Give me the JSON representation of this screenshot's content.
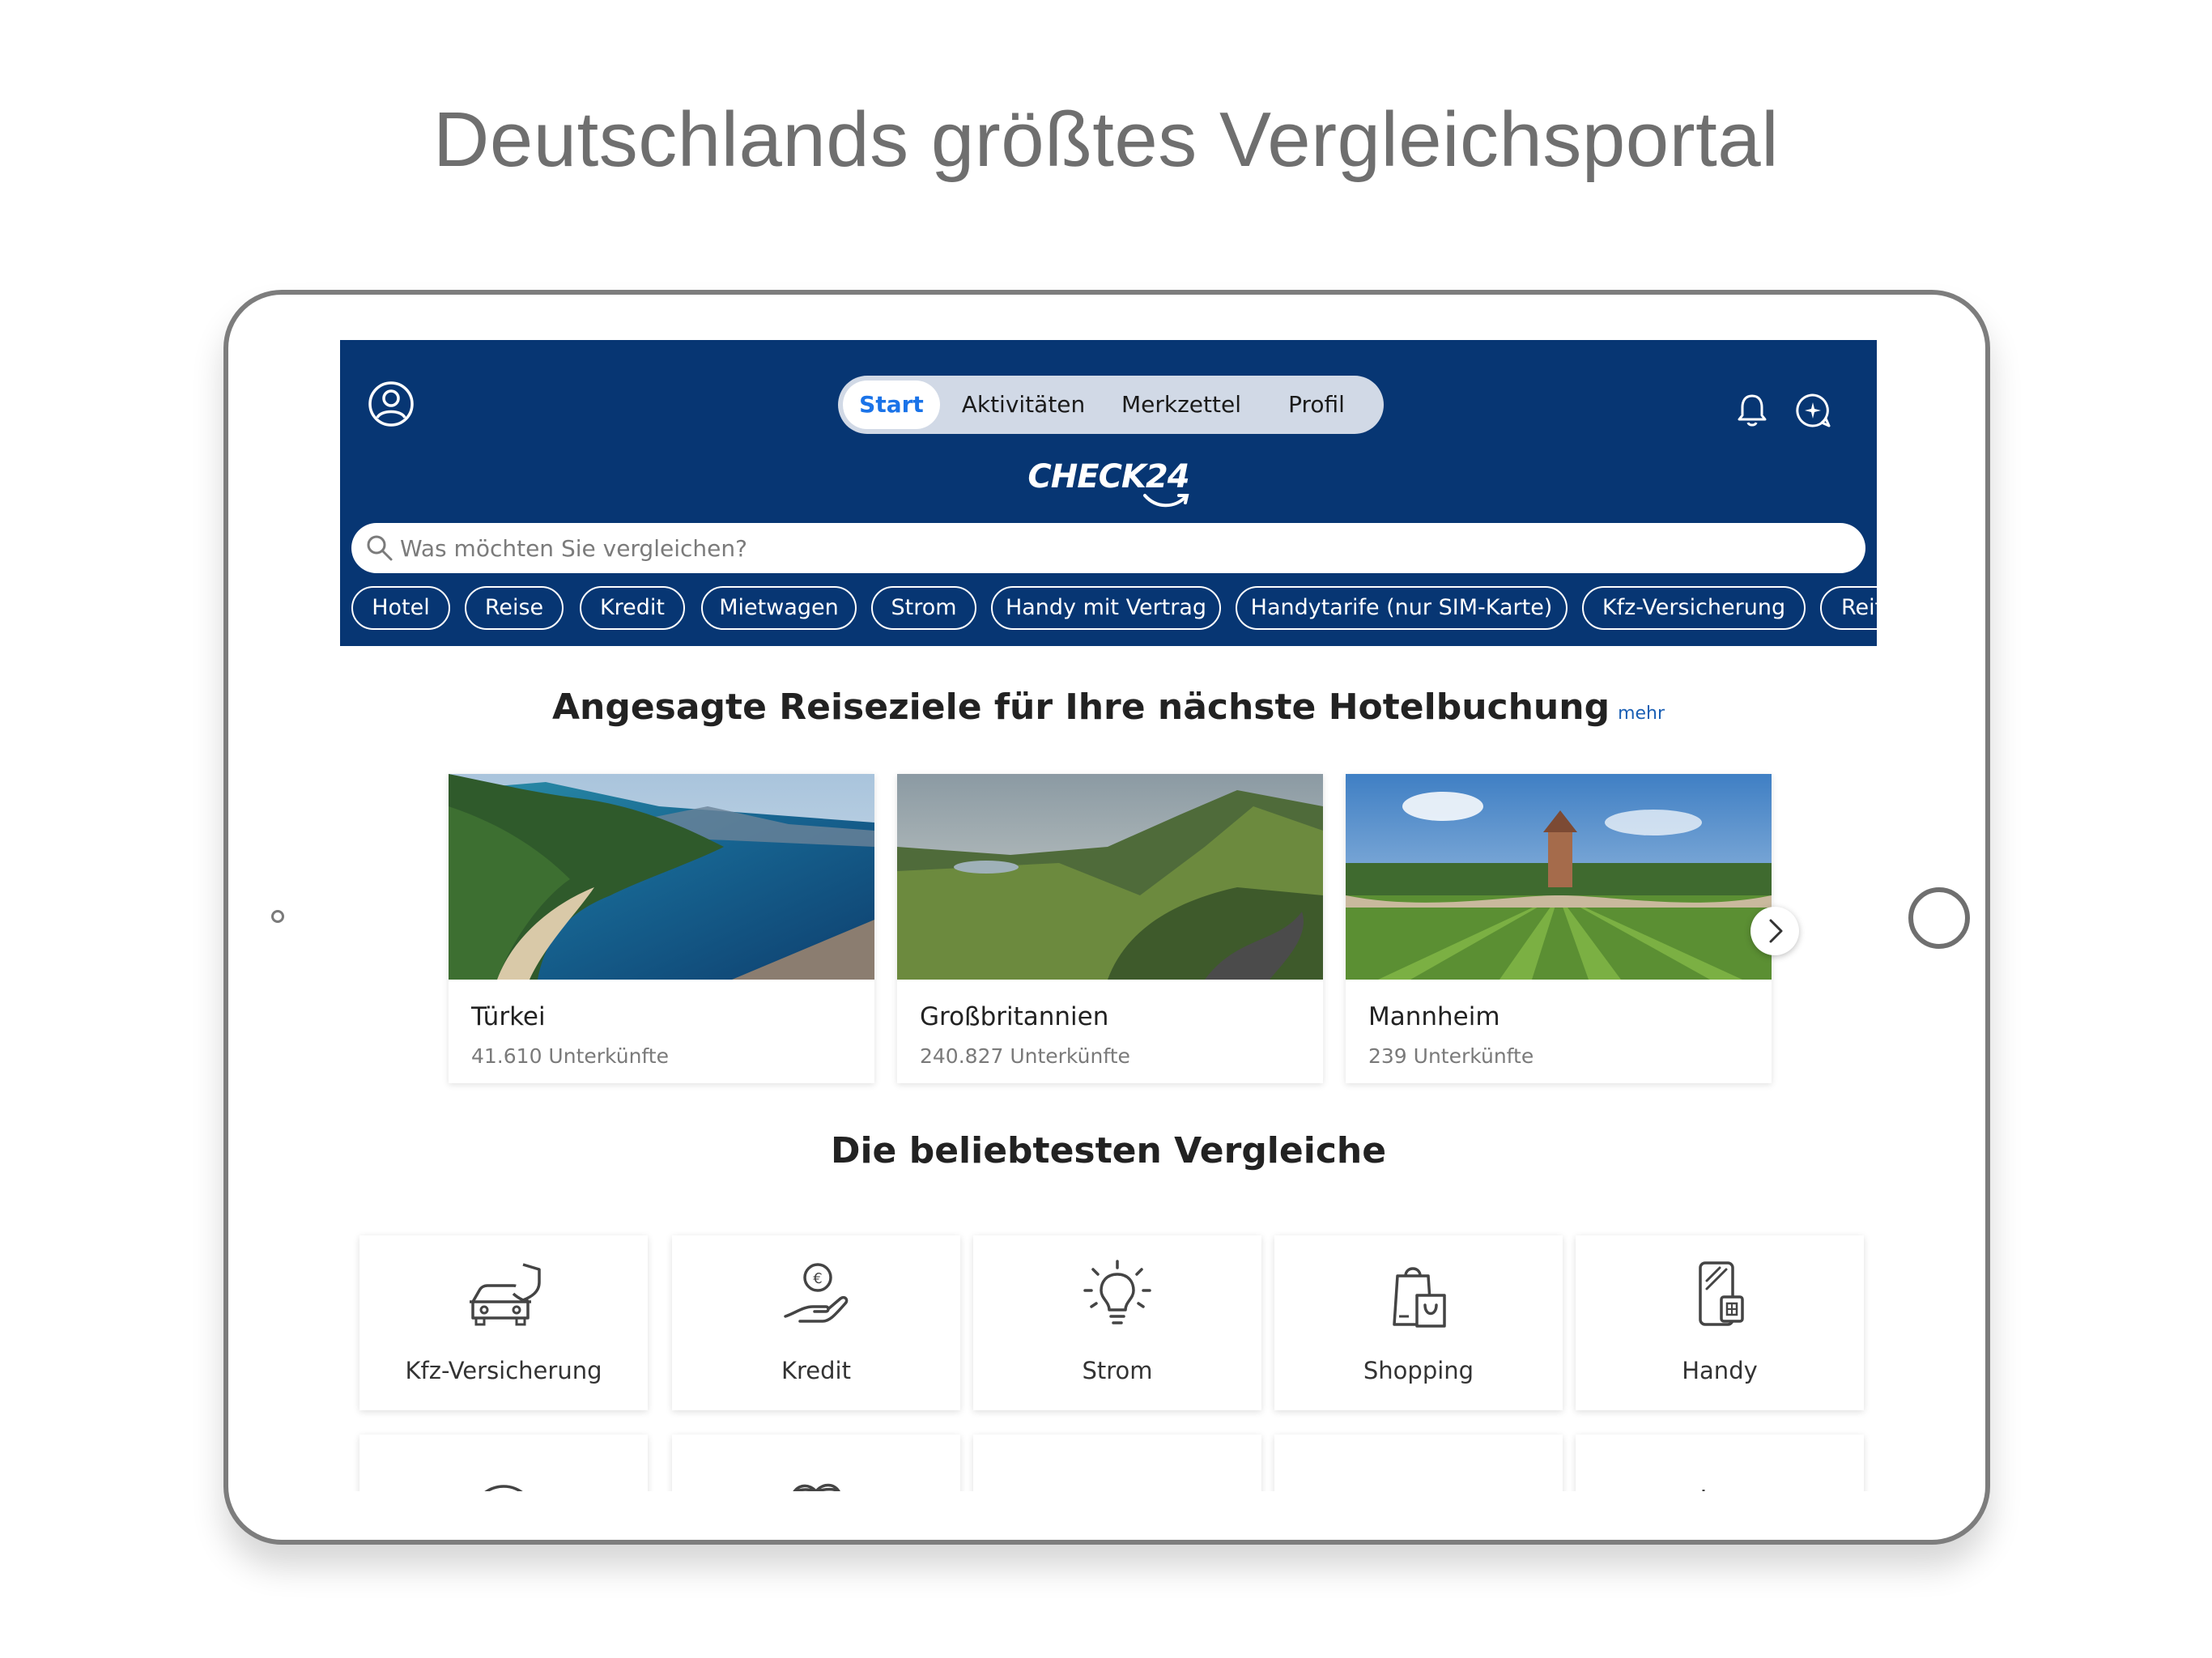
{
  "headline": "Deutschlands größtes Vergleichsportal",
  "header": {
    "nav_tabs": [
      {
        "label": "Start",
        "active": true
      },
      {
        "label": "Aktivitäten",
        "active": false
      },
      {
        "label": "Merkzettel",
        "active": false
      },
      {
        "label": "Profil",
        "active": false
      }
    ],
    "logo": "CHECK24",
    "search_placeholder": "Was möchten Sie vergleichen?",
    "chips": [
      "Hotel",
      "Reise",
      "Kredit",
      "Mietwagen",
      "Strom",
      "Handy mit Vertrag",
      "Handytarife (nur SIM-Karte)",
      "Kfz-Versicherung",
      "Reifen"
    ]
  },
  "hotel_section": {
    "title": "Angesagte Reiseziele für Ihre nächste Hotelbuchung",
    "more_link": "mehr",
    "cards": [
      {
        "name": "Türkei",
        "count": "41.610 Unterkünfte"
      },
      {
        "name": "Großbritannien",
        "count": "240.827 Unterkünfte"
      },
      {
        "name": "Mannheim",
        "count": "239 Unterkünfte"
      }
    ]
  },
  "comparisons_section": {
    "title": "Die beliebtesten Vergleiche",
    "tiles": [
      {
        "label": "Kfz-Versicherung",
        "icon": "car-shield-icon"
      },
      {
        "label": "Kredit",
        "icon": "hand-euro-icon"
      },
      {
        "label": "Strom",
        "icon": "lightbulb-icon"
      },
      {
        "label": "Shopping",
        "icon": "shopping-bags-icon"
      },
      {
        "label": "Handy",
        "icon": "phone-sim-icon"
      }
    ]
  },
  "colors": {
    "header_bg": "#073673",
    "active_tab_text": "#1a73e8",
    "link": "#1a5fb4"
  }
}
